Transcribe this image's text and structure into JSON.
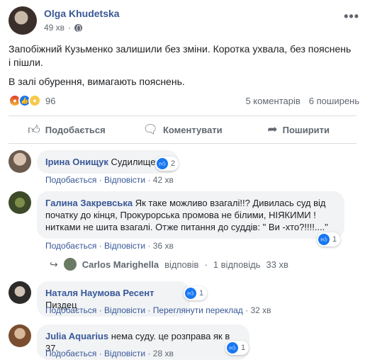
{
  "post": {
    "author": "Olga Khudetska",
    "time": "49 хв",
    "paragraphs": [
      "Запобіжний Кузьменко залишили без зміни. Коротка ухвала, без пояснень і пішли.",
      "В залі обурення, вимагають пояснень."
    ],
    "reaction_count": "96",
    "comments_count": "5 коментарів",
    "shares_count": "6 поширень",
    "reaction_colors": {
      "angry": "#e03a2a",
      "like": "#1877f2",
      "sad": "#f7c94a"
    }
  },
  "actions": {
    "like": "Подобається",
    "comment": "Коментувати",
    "share": "Поширити"
  },
  "comments": [
    {
      "name": "Ірина Онищук",
      "text": "Судилище",
      "likes": "2",
      "meta_like": "Подобається",
      "meta_reply": "Відповісти",
      "time": "42 хв"
    },
    {
      "name": "Галина Закревська",
      "text": "Як таке можливо взагалі!!? Дивилась суд від початку до кінця, Прокурорська промова не білими, НІЯКИМИ ! нитками не шита взагалі. Отже питання до суддів: \" Ви -хто?!!!!....\"",
      "likes": "1",
      "meta_like": "Подобається",
      "meta_reply": "Відповісти",
      "time": "36 хв"
    },
    {
      "name": "Наталя Наумова Ресент",
      "text": "Пиздец",
      "likes": "1",
      "meta_like": "Подобається",
      "meta_reply": "Відповісти",
      "meta_translate": "Переглянути переклад",
      "time": "32 хв"
    },
    {
      "name": "Julia Aquarius",
      "text": "нема суду. це розправа як в 37.",
      "likes": "1",
      "meta_like": "Подобається",
      "meta_reply": "Відповісти",
      "time": "28 хв"
    }
  ],
  "reply": {
    "name": "Carlos Marighella",
    "verb": "відповів",
    "count": "1 відповідь",
    "time": "33 хв"
  },
  "accent_color": "#385898"
}
